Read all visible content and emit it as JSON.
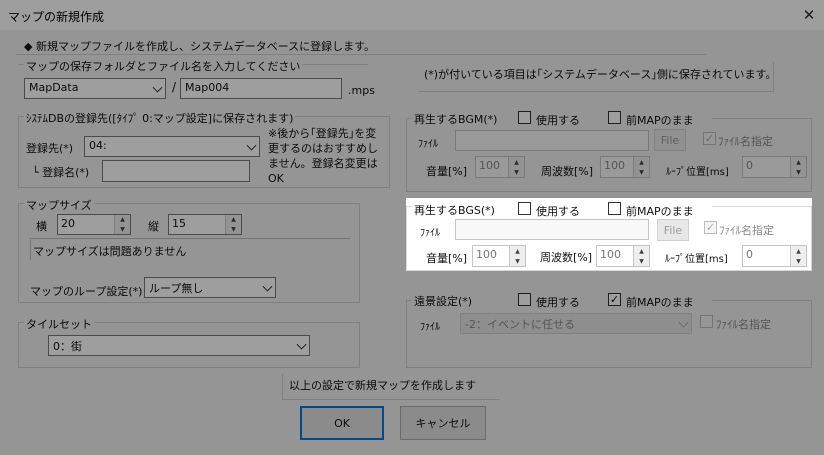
{
  "window": {
    "title": "マップの新規作成",
    "close_glyph": "✕"
  },
  "info": "◆ 新規マップファイルを作成し、システムデータベースに登録します。",
  "note_right": "(*)が付いている項目は｢システムデータベース｣側に保存されています。",
  "save": {
    "group_label": "マップの保存フォルダとファイル名を入力してください",
    "folder": "MapData",
    "separator": "/",
    "filename": "Map004",
    "ext": ".mps"
  },
  "sysdb": {
    "group_label": "ｼｽﾃﾑDBの登録先([ﾀｲﾌﾟ 0:マップ設定]に保存されます)",
    "dest_label": "登録先(*)",
    "dest_value": "04:",
    "name_label": "└ 登録名(*)",
    "name_value": "",
    "warning": "※後から｢登録先｣を変更するのはおすすめしません。登録名変更はOK"
  },
  "mapsize": {
    "group_label": "マップサイズ",
    "w_label": "横",
    "w_value": "20",
    "h_label": "縦",
    "h_value": "15",
    "message": "マップサイズは問題ありません",
    "loop_label": "マップのループ設定(*)",
    "loop_value": "ループ無し"
  },
  "tileset": {
    "group_label": "タイルセット",
    "value": "0：街"
  },
  "bgm": {
    "title": "再生するBGM(*)",
    "use_label": "使用する",
    "use_checked": false,
    "prev_label": "前MAPのまま",
    "prev_checked": false,
    "file_label": "ﾌｧｲﾙ",
    "file_value": "",
    "file_button": "File",
    "name_spec_label": "ﾌｧｲﾙ名指定",
    "name_spec_checked": true,
    "vol_label": "音量[%]",
    "vol_value": "100",
    "freq_label": "周波数[%]",
    "freq_value": "100",
    "loop_label": "ﾙｰﾌﾟ位置[ms]",
    "loop_value": "0"
  },
  "bgs": {
    "title": "再生するBGS(*)",
    "use_label": "使用する",
    "use_checked": false,
    "prev_label": "前MAPのまま",
    "prev_checked": false,
    "file_label": "ﾌｧｲﾙ",
    "file_value": "",
    "file_button": "File",
    "name_spec_label": "ﾌｧｲﾙ名指定",
    "name_spec_checked": true,
    "vol_label": "音量[%]",
    "vol_value": "100",
    "freq_label": "周波数[%]",
    "freq_value": "100",
    "loop_label": "ﾙｰﾌﾟ位置[ms]",
    "loop_value": "0"
  },
  "scenery": {
    "title": "遠景設定(*)",
    "use_label": "使用する",
    "use_checked": false,
    "prev_label": "前MAPのまま",
    "prev_checked": true,
    "file_label": "ﾌｧｲﾙ",
    "file_value": "-2：イベントに任せる",
    "name_spec_label": "ﾌｧｲﾙ名指定",
    "name_spec_checked": false
  },
  "create_note": "以上の設定で新規マップを作成します",
  "buttons": {
    "ok": "OK",
    "cancel": "キャンセル"
  },
  "glyphs": {
    "check": "✓",
    "spin_up": "▲",
    "spin_down": "▼"
  }
}
